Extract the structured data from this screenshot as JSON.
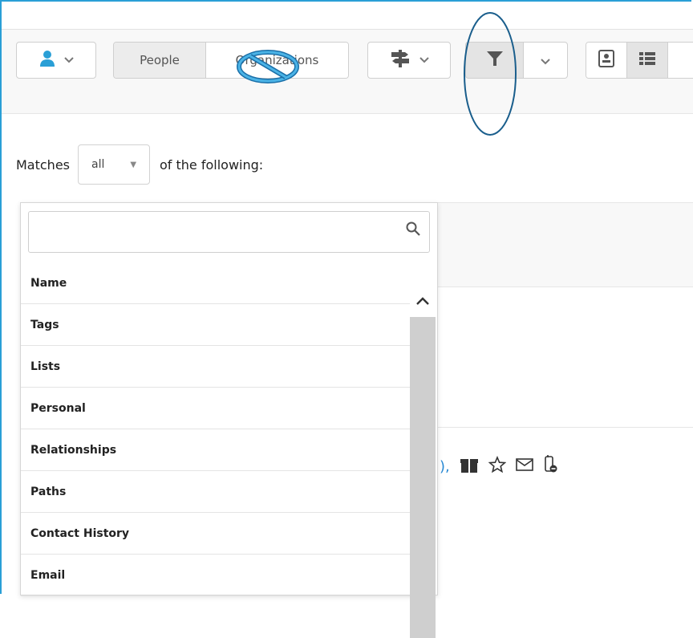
{
  "toolbar": {
    "people_label": "People",
    "organizations_label": "Organizations"
  },
  "filter": {
    "matches_label": "Matches",
    "matches_value": "all",
    "following_label": "of the following:"
  },
  "dropdown": {
    "search_placeholder": "",
    "items": [
      {
        "label": "Name"
      },
      {
        "label": "Tags"
      },
      {
        "label": "Lists"
      },
      {
        "label": "Personal"
      },
      {
        "label": "Relationships"
      },
      {
        "label": "Paths"
      },
      {
        "label": "Contact History"
      },
      {
        "label": "Email"
      }
    ]
  },
  "results": {
    "link_fragment": "),"
  },
  "colors": {
    "accent": "#2a9fd6",
    "annotation": "#1a6fa8",
    "link": "#2a8ad4"
  },
  "icons": [
    "person-icon",
    "signpost-icon",
    "filter-funnel-icon",
    "contact-card-icon",
    "list-view-icon",
    "search-icon",
    "scroll-up-icon",
    "gift-icon",
    "star-icon",
    "envelope-icon",
    "phone-blocked-icon"
  ]
}
